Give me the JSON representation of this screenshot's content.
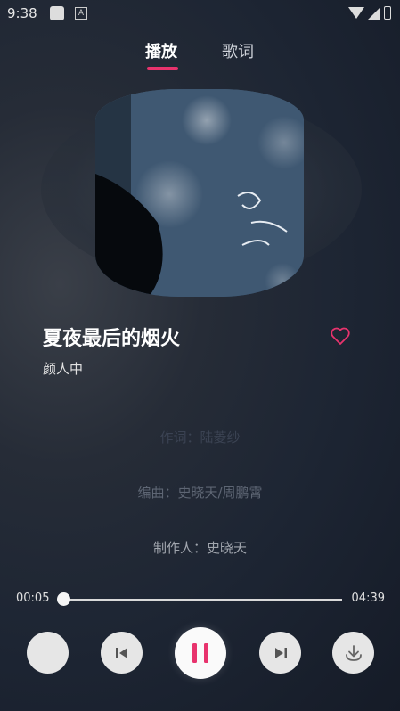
{
  "status_bar": {
    "time": "9:38",
    "icon_label": "A"
  },
  "tabs": [
    {
      "label": "播放",
      "active": true
    },
    {
      "label": "歌词",
      "active": false
    }
  ],
  "song": {
    "title": "夏夜最后的烟火",
    "artist": "颜人中"
  },
  "lyrics": [
    "作词：陆菱纱",
    "编曲：史晓天/周鹏霄",
    "制作人：史晓天"
  ],
  "player": {
    "current_time": "00:05",
    "total_time": "04:39",
    "progress": 0.018
  },
  "icons": {
    "tab_indicator_color": "#e8336d",
    "heart": "heart-outline-icon",
    "prev": "skip-previous-icon",
    "pause": "pause-icon",
    "next": "skip-next-icon",
    "download": "download-icon"
  }
}
